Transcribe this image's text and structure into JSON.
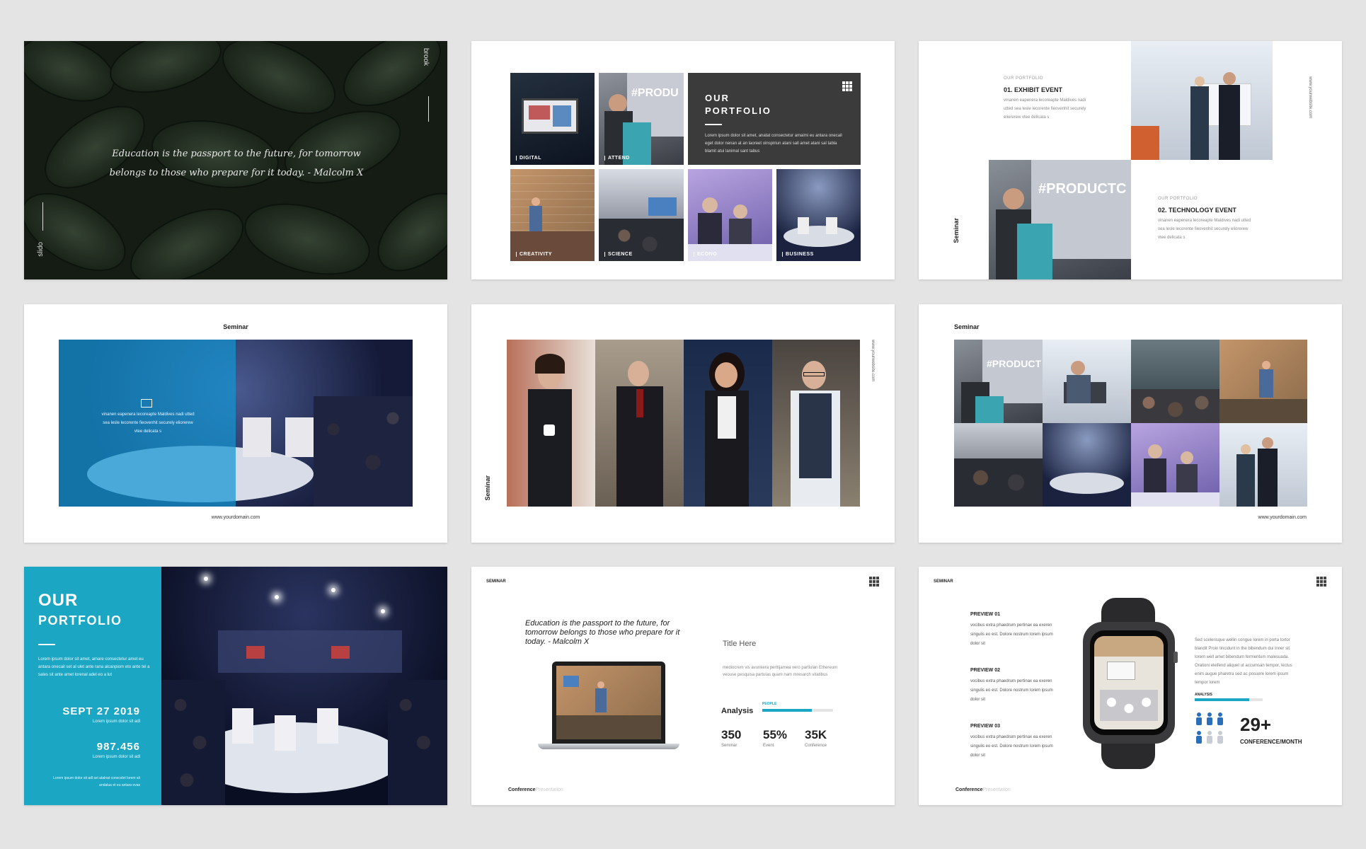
{
  "slide1": {
    "quote": "Education is the passport to the future, for tomorrow belongs to those who prepare for it today. - Malcolm X",
    "brand_top": "brook",
    "brand_bottom": "slido"
  },
  "slide2": {
    "title_line1": "OUR",
    "title_line2": "PORTFOLIO",
    "body": "Lorem ipsum dolor sit amet, anatat consectetur amaimi eu antara onecail eget dolor nenan at an laoreet oinspiriun atani sall amet atani sal tabla blamit atui lanimal sant tabus",
    "captions": [
      "DIGITAL",
      "ATTEND",
      "CREATIVITY",
      "SCIENCE",
      "ECONO",
      "BUSINESS"
    ]
  },
  "slide3": {
    "kicker1": "OUR PORTFOLIO",
    "heading1": "01. EXHIBIT EVENT",
    "text1": "vinanen eapenera lecoreapte Maldives nadi utted sea lesle lecorente fieovenhit securely eliorerew vtee delicata s",
    "kicker2": "OUR PORTFOLIO",
    "heading2": "02. TECHNOLOGY EVENT",
    "text2": "vinanen eapenera lecoreapte Maldives nadi utted sea lesle lecorente fieovenhit securely eliorerew vtee delicata s",
    "side": "www.yourwebsite.com",
    "seminar": "Seminar"
  },
  "slide4": {
    "title": "Seminar",
    "text": "vinanen eapenera lecoreapte Maldives nadi utted sea lesle lecorente fieovenhit securely eliorerew vtee delicata s",
    "footer": "www.yourdomain.com"
  },
  "slide5": {
    "side": "www.yourwebsite.com",
    "seminar": "Seminar"
  },
  "slide6": {
    "title": "Seminar",
    "footer": "www.yourdomain.com"
  },
  "slide7": {
    "title_line1": "OUR",
    "title_line2": "PORTFOLIO",
    "body": "Lorem ipsum dolor sit amet, amare consectetur amet eu antara onecail set al ulet ante rana alcanpiom eto ante tel a sales sit ante amet lorenal adel eo a lut",
    "date": "SEPT 27 2019",
    "date_sub": "Lorem ipsum dolor sit adl",
    "number": "987.456",
    "number_sub": "Lorem ipsum dolor sit adl",
    "footer_text": "Lorem ipsum dolor sit adl sei atalnat conecslet lorem sit andalua et eu antara ovas"
  },
  "slide8": {
    "header": "SEMINAR",
    "quote": "Education is the passport to the future, for tomorrow belongs to those who prepare for it today. - Malcolm X",
    "title": "Title Here",
    "desc": "mediocrem vis avunkera perttijamea vero partiulan Ethereum veouse pesquisa partulas quam nam mresarch vitatibus",
    "analysis": "Analysis",
    "people": "PEOPLE",
    "stats": [
      {
        "value": "350",
        "label": "Seminar"
      },
      {
        "value": "55%",
        "label": "Event"
      },
      {
        "value": "35K",
        "label": "Conference"
      }
    ],
    "footer_bold": "Conference",
    "footer_light": "Presentation",
    "people_progress": 0.7
  },
  "slide9": {
    "header": "SEMINAR",
    "previews": [
      {
        "title": "PREVIEW 01",
        "text": "vocibus extra phaedrum pertinax ea exeren singulis eo est. Dolore nostrum lorem ipsum dolor sit"
      },
      {
        "title": "PREVIEW 02",
        "text": "vocibus extra phaedrum pertinax ea exeren singulis eo est. Dolore nostrum lorem ipsum dolor sit"
      },
      {
        "title": "PREVIEW 03",
        "text": "vocibus extra phaedrum pertinax ea exeren singulis eo est. Dolore nostrum lorem ipsum dolor sit"
      }
    ],
    "right_text": "Sed scelerisque wellin congue lorem in porta tortor blandit Proin tincidunt in the bibendum dui inner sit lorem well amet bibendum fermentum malesuada. Orationi eleifend aliquet ut accumsan tempor, lectus enim augue pharetra sed ac posuere lorem ipsum tempor lorem",
    "analysis": "ANALYSIS",
    "big_number": "29+",
    "big_label": "CONFERENCE/MONTH",
    "footer_bold": "Conference",
    "footer_light": "Presentation",
    "analysis_progress": 0.8,
    "people_filled": 4,
    "people_total": 6
  }
}
